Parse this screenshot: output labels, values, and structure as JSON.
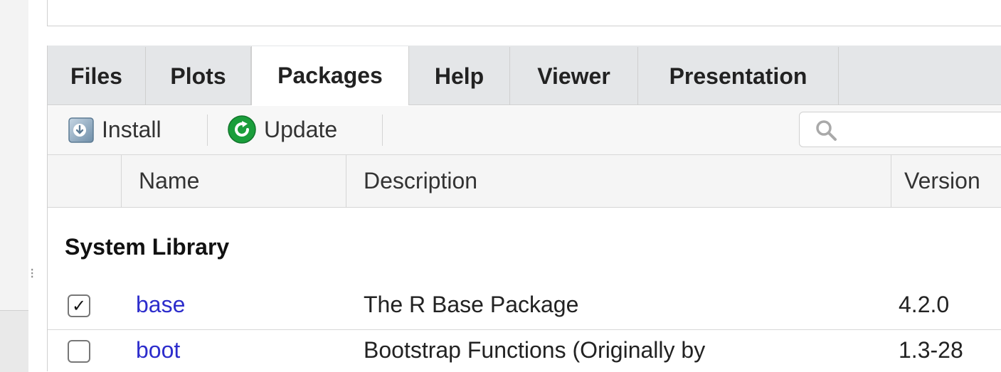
{
  "tabs": [
    "Files",
    "Plots",
    "Packages",
    "Help",
    "Viewer",
    "Presentation"
  ],
  "active_tab": "Packages",
  "toolbar": {
    "install_label": "Install",
    "update_label": "Update",
    "search_placeholder": ""
  },
  "columns": {
    "name": "Name",
    "description": "Description",
    "version": "Version"
  },
  "section_title": "System Library",
  "packages": [
    {
      "checked": true,
      "name": "base",
      "description": "The R Base Package",
      "version": "4.2.0"
    },
    {
      "checked": false,
      "name": "boot",
      "description": "Bootstrap Functions (Originally by",
      "version": "1.3-28"
    }
  ],
  "colors": {
    "link": "#2d2dcc",
    "update_icon": "#1a9e3b",
    "install_icon": "#6f8ea8"
  }
}
